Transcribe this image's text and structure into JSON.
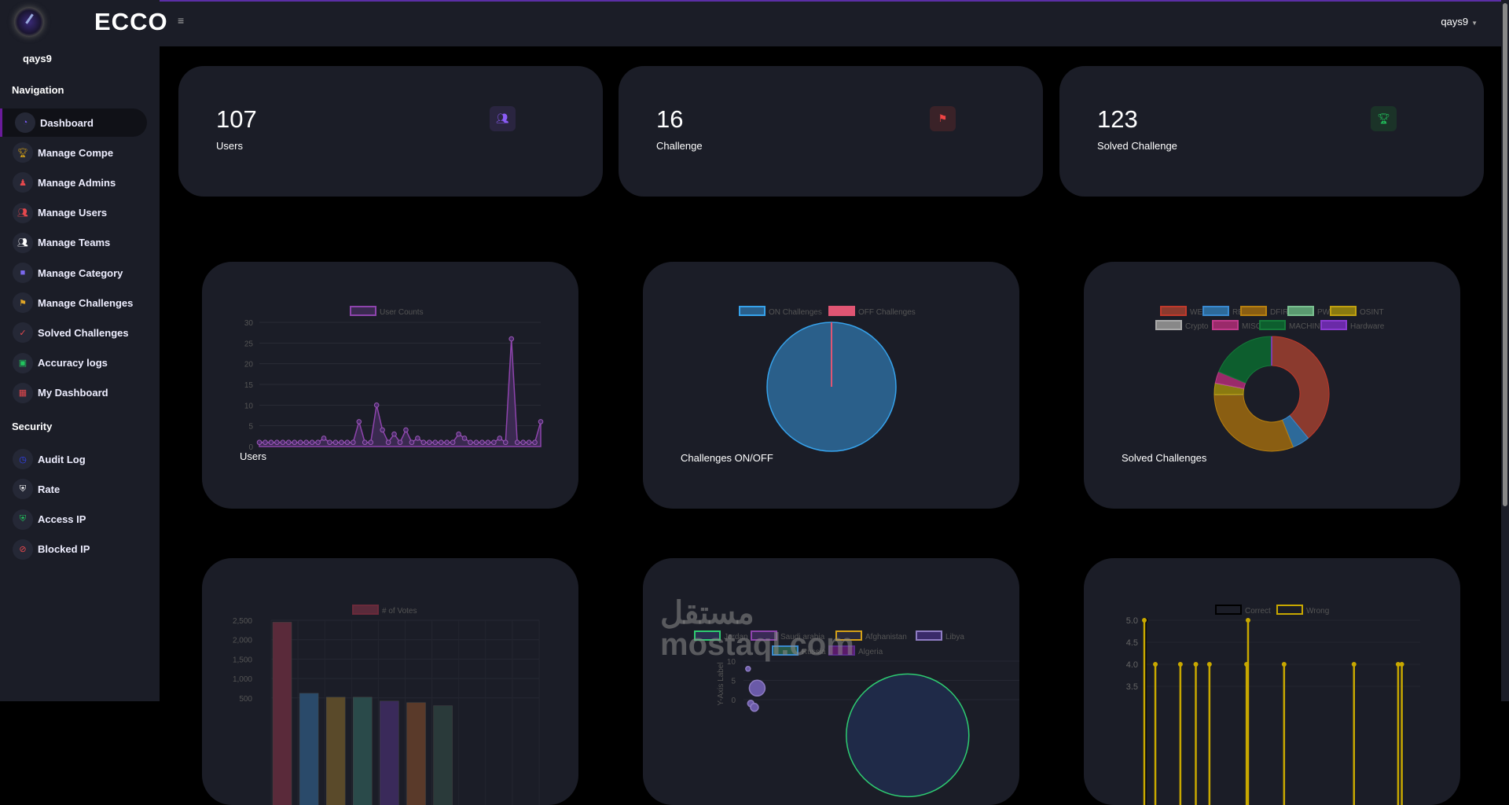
{
  "header": {
    "brand": "ECCO",
    "menu_icon": "≡",
    "user": "qays9"
  },
  "sidebar": {
    "username": "qays9",
    "nav_heading": "Navigation",
    "nav": [
      {
        "label": "Dashboard",
        "icon": "gauge-icon",
        "glyph": "◔",
        "color": "#7c5cff",
        "active": true
      },
      {
        "label": "Manage Compe",
        "icon": "trophy-icon",
        "glyph": "🏆︎",
        "color": "#d4a017"
      },
      {
        "label": "Manage Admins",
        "icon": "admin-icon",
        "glyph": "♟",
        "color": "#e5484d"
      },
      {
        "label": "Manage Users",
        "icon": "users-icon",
        "glyph": "👥︎",
        "color": "#e5484d"
      },
      {
        "label": "Manage Teams",
        "icon": "teams-icon",
        "glyph": "👥︎",
        "color": "#ffffff"
      },
      {
        "label": "Manage Category",
        "icon": "folder-icon",
        "glyph": "■",
        "color": "#7b68ee"
      },
      {
        "label": "Manage Challenges",
        "icon": "flag-icon",
        "glyph": "⚑",
        "color": "#e0a526"
      },
      {
        "label": "Solved Challenges",
        "icon": "check-icon",
        "glyph": "✓",
        "color": "#e5484d"
      },
      {
        "label": "Accuracy logs",
        "icon": "accuracy-icon",
        "glyph": "▣",
        "color": "#22c55e"
      },
      {
        "label": "My Dashboard",
        "icon": "grid-icon",
        "glyph": "▦",
        "color": "#e5484d"
      }
    ],
    "security_heading": "Security",
    "security": [
      {
        "label": "Audit Log",
        "icon": "history-icon",
        "glyph": "◷",
        "color": "#3344ff"
      },
      {
        "label": "Rate",
        "icon": "shield-icon",
        "glyph": "⛨",
        "color": "#ffffff"
      },
      {
        "label": "Access IP",
        "icon": "shield-check-icon",
        "glyph": "⛨",
        "color": "#22c55e"
      },
      {
        "label": "Blocked IP",
        "icon": "ban-icon",
        "glyph": "⊘",
        "color": "#e5484d"
      }
    ]
  },
  "stats": [
    {
      "value": "107",
      "label": "Users",
      "icon": "users-icon",
      "glyph": "👥︎",
      "color": "#8b5cf6",
      "bg": "#2a2540"
    },
    {
      "value": "16",
      "label": "Challenge",
      "icon": "flag-icon",
      "glyph": "⚑",
      "color": "#ef4444",
      "bg": "#3a2228"
    },
    {
      "value": "123",
      "label": "Solved Challenge",
      "icon": "trophy-icon",
      "glyph": "🏆︎",
      "color": "#22c55e",
      "bg": "#1b3328"
    }
  ],
  "chart_data": [
    {
      "type": "line",
      "title": "Users",
      "legend": [
        "User Counts"
      ],
      "ylim": [
        0,
        30
      ],
      "yticks": [
        0,
        5,
        10,
        15,
        20,
        25,
        30
      ],
      "color": "#8e44ad",
      "values": [
        1,
        1,
        1,
        1,
        1,
        1,
        1,
        1,
        1,
        1,
        1,
        2,
        1,
        1,
        1,
        1,
        1,
        6,
        1,
        1,
        10,
        4,
        1,
        3,
        1,
        4,
        1,
        2,
        1,
        1,
        1,
        1,
        1,
        1,
        3,
        2,
        1,
        1,
        1,
        1,
        1,
        2,
        1,
        26,
        1,
        1,
        1,
        1,
        6
      ]
    },
    {
      "type": "pie",
      "title": "Challenges ON/OFF",
      "categories": [
        "ON Challenges",
        "OFF Challenges"
      ],
      "values": [
        16,
        0
      ],
      "colors": [
        "#2a5f8a",
        "#e05573"
      ],
      "borders": [
        "#36a2eb",
        "#e05573"
      ]
    },
    {
      "type": "pie",
      "title": "Solved Challenges",
      "categories": [
        "WEB",
        "RE",
        "DFIR",
        "PWN",
        "OSINT",
        "Crypto",
        "MISC",
        "MACHINE",
        "Hardware"
      ],
      "values": [
        48,
        6,
        38,
        0,
        4,
        0,
        4,
        23,
        0
      ],
      "colors": [
        "#8b3a2e",
        "#2d6a9a",
        "#8a5e12",
        "#5a9a70",
        "#8a7a10",
        "#888888",
        "#9a2a6a",
        "#0d5e2e",
        "#6a2aa8"
      ],
      "borders": [
        "#c0392b",
        "#3a8ad0",
        "#b8800f",
        "#7ac090",
        "#c0a010",
        "#aaaaaa",
        "#c03a8a",
        "#157a3a",
        "#8a3ad0"
      ]
    },
    {
      "type": "bar",
      "title": "",
      "legend": [
        "# of Votes"
      ],
      "ylim": [
        0,
        2500
      ],
      "yticks": [
        "500",
        "1,000",
        "1,500",
        "2,000",
        "2,500"
      ],
      "values": [
        2450,
        620,
        520,
        520,
        420,
        380,
        300
      ],
      "slots": 10,
      "colors": [
        "#5a2a3a",
        "#2a4a6a",
        "#5a4a2a",
        "#2a4a4a",
        "#3a2a5a",
        "#5a3a2a",
        "#2a3a3a"
      ]
    },
    {
      "type": "bubble",
      "legend": [
        "Jordan",
        "Saudi arabia",
        "Afghanistan",
        "Libya",
        "Russia",
        "Algeria"
      ],
      "legend_colors": [
        "#2ecc71",
        "#8e44ad",
        "#d4a017",
        "#8e7cc3",
        "#3a8ad0",
        "#5a2a8a"
      ],
      "ylabel": "Y-Axis Label",
      "yticks": [
        0,
        5,
        10
      ],
      "points": [
        {
          "x": 0.5,
          "y": 8,
          "r": 3
        },
        {
          "x": 1.5,
          "y": 3,
          "r": 10
        },
        {
          "x": 0.8,
          "y": -1,
          "r": 4
        },
        {
          "x": 1.2,
          "y": -2,
          "r": 5
        },
        {
          "x": 18,
          "y": -6,
          "r": 78
        }
      ]
    },
    {
      "type": "line",
      "legend": [
        "Correct",
        "Wrong"
      ],
      "legend_colors": [
        "#000000",
        "#c8a800"
      ],
      "yticks": [
        "3.5",
        "4.0",
        "4.5",
        "5.0"
      ],
      "ylim": [
        0,
        5
      ],
      "n": 75,
      "series": [
        {
          "name": "Correct",
          "color": "#000000",
          "points": [
            [
              0.3,
              5
            ]
          ]
        },
        {
          "name": "Wrong",
          "color": "#c8a800",
          "points": [
            [
              0,
              5
            ],
            [
              3,
              4
            ],
            [
              9.8,
              4
            ],
            [
              14,
              4
            ],
            [
              17.7,
              4
            ],
            [
              27.8,
              4
            ],
            [
              28.2,
              5
            ],
            [
              38,
              4
            ],
            [
              57,
              4
            ],
            [
              69,
              4
            ],
            [
              70,
              4
            ]
          ]
        }
      ]
    }
  ],
  "watermark": "مستقل mostaql.com"
}
